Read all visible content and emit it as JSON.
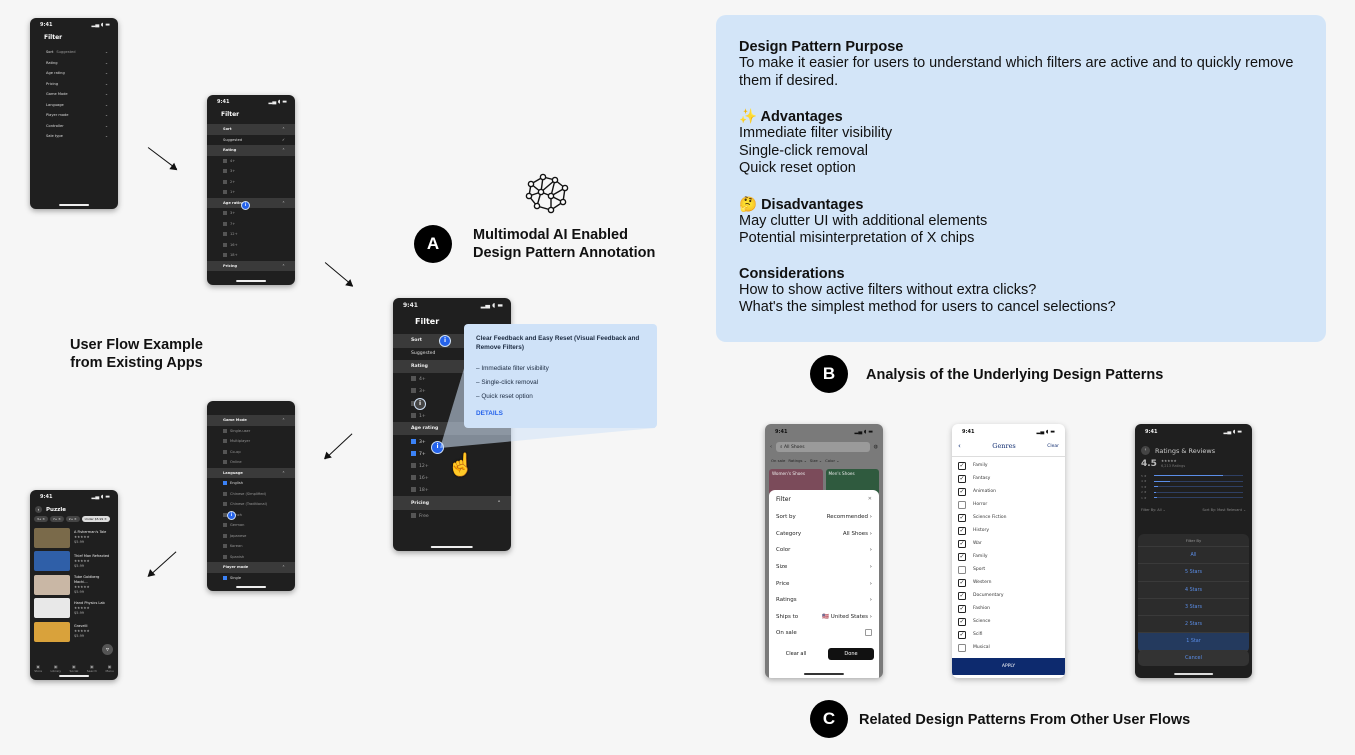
{
  "left_section": {
    "label_line1": "User Flow Example",
    "label_line2": "from Existing Apps"
  },
  "annotation": {
    "badge": "A",
    "title_line1": "Multimodal AI Enabled",
    "title_line2": "Design Pattern Annotation"
  },
  "phone_common": {
    "time": "9:41",
    "filter_title": "Filter"
  },
  "phone1": {
    "rows": [
      {
        "label": "Sort",
        "value": "Suggested"
      },
      {
        "label": "Rating",
        "value": ""
      },
      {
        "label": "Age rating",
        "value": ""
      },
      {
        "label": "Pricing",
        "value": ""
      },
      {
        "label": "Game Mode",
        "value": ""
      },
      {
        "label": "Language",
        "value": ""
      },
      {
        "label": "Player mode",
        "value": ""
      },
      {
        "label": "Controller",
        "value": ""
      },
      {
        "label": "Sale type",
        "value": ""
      }
    ]
  },
  "phone2": {
    "rows": [
      {
        "label": "Sort",
        "kind": "grp"
      },
      {
        "label": "Suggested",
        "kind": "opt"
      },
      {
        "label": "Rating",
        "kind": "grp"
      },
      {
        "label": "4+",
        "kind": "sub"
      },
      {
        "label": "3+",
        "kind": "sub"
      },
      {
        "label": "2+",
        "kind": "sub"
      },
      {
        "label": "1+",
        "kind": "sub"
      },
      {
        "label": "Age rating",
        "kind": "grp"
      },
      {
        "label": "3+",
        "kind": "sub"
      },
      {
        "label": "7+",
        "kind": "sub"
      },
      {
        "label": "12+",
        "kind": "sub"
      },
      {
        "label": "16+",
        "kind": "sub"
      },
      {
        "label": "18+",
        "kind": "sub"
      },
      {
        "label": "Pricing",
        "kind": "grp"
      }
    ]
  },
  "phone_center": {
    "rows": [
      {
        "label": "Sort",
        "kind": "grp"
      },
      {
        "label": "Suggested",
        "kind": "opt"
      },
      {
        "label": "Rating",
        "kind": "grp"
      },
      {
        "label": "4+",
        "kind": "sub"
      },
      {
        "label": "3+",
        "kind": "sub"
      },
      {
        "label": "2+",
        "kind": "sub"
      },
      {
        "label": "1+",
        "kind": "sub"
      },
      {
        "label": "Age rating",
        "kind": "grp"
      },
      {
        "label": "3+",
        "kind": "chk"
      },
      {
        "label": "7+",
        "kind": "chk"
      },
      {
        "label": "12+",
        "kind": "sub"
      },
      {
        "label": "16+",
        "kind": "sub"
      },
      {
        "label": "18+",
        "kind": "sub"
      },
      {
        "label": "Pricing",
        "kind": "grp"
      },
      {
        "label": "Free",
        "kind": "sub"
      }
    ],
    "popup": {
      "title": "Clear Feedback and Easy Reset (Visual Feedback and Remove Filters)",
      "items": [
        "– Immediate filter visibility",
        "– Single-click removal",
        "– Quick reset option"
      ],
      "link": "DETAILS"
    }
  },
  "phone3": {
    "rows": [
      {
        "label": "Game Mode",
        "kind": "grp"
      },
      {
        "label": "Single-user",
        "kind": "sub"
      },
      {
        "label": "Multiplayer",
        "kind": "sub"
      },
      {
        "label": "Co-op",
        "kind": "sub"
      },
      {
        "label": "Online",
        "kind": "sub"
      },
      {
        "label": "Language",
        "kind": "grp"
      },
      {
        "label": "English",
        "kind": "chk"
      },
      {
        "label": "Chinese (Simplified)",
        "kind": "sub"
      },
      {
        "label": "Chinese (Traditional)",
        "kind": "sub"
      },
      {
        "label": "French",
        "kind": "sub"
      },
      {
        "label": "German",
        "kind": "sub"
      },
      {
        "label": "Japanese",
        "kind": "sub"
      },
      {
        "label": "Korean",
        "kind": "sub"
      },
      {
        "label": "Spanish",
        "kind": "sub"
      },
      {
        "label": "Player mode",
        "kind": "grp"
      },
      {
        "label": "Single",
        "kind": "chk"
      }
    ]
  },
  "phone4": {
    "title": "Puzzle",
    "chips": [
      "3+ ✕",
      "7+ ✕",
      "2+ ✕",
      "Under $5.99 ✕"
    ],
    "apps": [
      {
        "name": "A Fisherman's Tale",
        "price": "$5.99",
        "color": "#7a6a4a"
      },
      {
        "name": "Thief Man Refracted",
        "price": "$5.99",
        "color": "#2f5fa8"
      },
      {
        "name": "Tube Goldberg Machi...",
        "price": "$5.99",
        "color": "#c9b7a5"
      },
      {
        "name": "Hand Physics Lab",
        "price": "$5.99",
        "color": "#e8e8e8"
      },
      {
        "name": "Gravelli",
        "price": "$5.99",
        "color": "#d9a23b"
      }
    ],
    "nav": [
      "Store",
      "Library",
      "Social",
      "Search",
      "Menu"
    ]
  },
  "design_info": {
    "purpose_title": "Design Pattern Purpose",
    "purpose_text": "To make it easier for users to understand which filters are active and to quickly remove them if desired.",
    "adv_title": "✨ Advantages",
    "adv_items": [
      "Immediate filter visibility",
      "Single-click removal",
      "Quick reset option"
    ],
    "dis_title": "🤔 Disadvantages",
    "dis_items": [
      "May clutter UI with additional elements",
      "Potential misinterpretation of X chips"
    ],
    "con_title": "Considerations",
    "con_items": [
      "How to show active filters without extra clicks?",
      "What's the simplest method for users to cancel selections?"
    ]
  },
  "analysis": {
    "badge": "B",
    "label": "Analysis of the Underlying Design Patterns"
  },
  "related": {
    "badge": "C",
    "label": "Related Design Patterns From Other User Flows"
  },
  "example1": {
    "search": "All Shoes",
    "chips": [
      "On sale",
      "Ratings ⌄",
      "Size ⌄",
      "Color ⌄"
    ],
    "tiles": [
      "Women's Shoes",
      "Men's Shoes"
    ],
    "title": "Filter",
    "rows": [
      {
        "label": "Sort by",
        "value": "Recommended"
      },
      {
        "label": "Category",
        "value": "All Shoes"
      },
      {
        "label": "Color",
        "value": ""
      },
      {
        "label": "Size",
        "value": ""
      },
      {
        "label": "Price",
        "value": ""
      },
      {
        "label": "Ratings",
        "value": ""
      },
      {
        "label": "Ships to",
        "value": "🇺🇸 United States"
      },
      {
        "label": "On sale",
        "value": ""
      }
    ],
    "clear": "Clear all",
    "done": "Done"
  },
  "example2": {
    "title": "Genres",
    "clear": "Clear",
    "genres": [
      {
        "name": "Family",
        "on": true
      },
      {
        "name": "Fantasy",
        "on": true
      },
      {
        "name": "Animation",
        "on": true
      },
      {
        "name": "Horror",
        "on": false
      },
      {
        "name": "Science Fiction",
        "on": true
      },
      {
        "name": "History",
        "on": true
      },
      {
        "name": "War",
        "on": true
      },
      {
        "name": "Family",
        "on": true
      },
      {
        "name": "Sport",
        "on": false
      },
      {
        "name": "Western",
        "on": true
      },
      {
        "name": "Documentary",
        "on": true
      },
      {
        "name": "Fashion",
        "on": true
      },
      {
        "name": "Science",
        "on": true
      },
      {
        "name": "Scifi",
        "on": true
      },
      {
        "name": "Musical",
        "on": false
      }
    ],
    "apply": "APPLY"
  },
  "example3": {
    "title": "Ratings & Reviews",
    "score": "4.5",
    "stars": "★★★★★",
    "count": "6,213 Ratings",
    "bars": [
      0.78,
      0.18,
      0.04,
      0.02,
      0.03
    ],
    "filter_by": "Filter By: All ⌄",
    "sort_by": "Sort By: Most Relevant ⌄",
    "sheet_title": "Filter By",
    "options": [
      "All",
      "5 Stars",
      "4 Stars",
      "3 Stars",
      "2 Stars",
      "1 Star"
    ],
    "cancel": "Cancel"
  },
  "colors": {
    "accent": "#2563eb",
    "panel": "#d3e5f8",
    "popup": "#cfe2f8",
    "apply": "#0d2a6e"
  }
}
